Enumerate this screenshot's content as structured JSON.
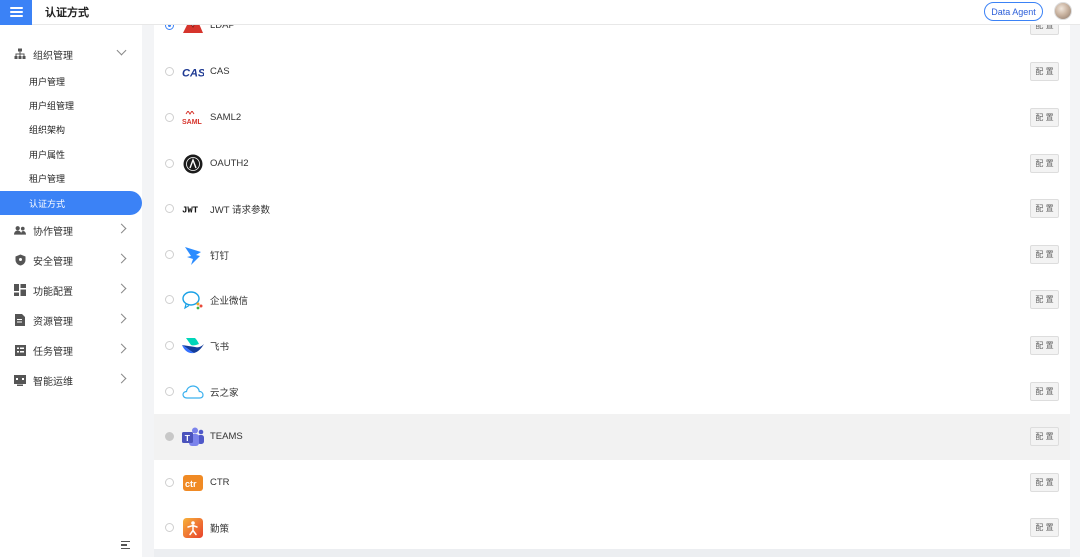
{
  "header": {
    "title": "认证方式",
    "agent_button": "Data Agent"
  },
  "sidebar": {
    "groups": [
      {
        "label": "组织管理",
        "icon": "org-icon",
        "expanded": true
      },
      {
        "label": "协作管理",
        "icon": "users-icon"
      },
      {
        "label": "安全管理",
        "icon": "shield-icon"
      },
      {
        "label": "功能配置",
        "icon": "grid-icon"
      },
      {
        "label": "资源管理",
        "icon": "file-icon"
      },
      {
        "label": "任务管理",
        "icon": "task-icon"
      },
      {
        "label": "智能运维",
        "icon": "monitor-icon"
      }
    ],
    "subitems": [
      "用户管理",
      "用户组管理",
      "组织架构",
      "用户属性",
      "租户管理",
      "认证方式"
    ],
    "active_subitem": "认证方式"
  },
  "auth_methods": [
    {
      "label": "LDAP",
      "logo": "ldap-logo",
      "selected": true
    },
    {
      "label": "CAS",
      "logo": "cas-logo"
    },
    {
      "label": "SAML2",
      "logo": "saml-logo"
    },
    {
      "label": "OAUTH2",
      "logo": "oauth-logo"
    },
    {
      "label": "JWT 请求参数",
      "logo": "jwt-logo"
    },
    {
      "label": "钉钉",
      "logo": "dingtalk-logo"
    },
    {
      "label": "企业微信",
      "logo": "wecom-logo"
    },
    {
      "label": "飞书",
      "logo": "feishu-logo"
    },
    {
      "label": "云之家",
      "logo": "yunzhijia-logo"
    },
    {
      "label": "TEAMS",
      "logo": "teams-logo",
      "hovered": true
    },
    {
      "label": "CTR",
      "logo": "ctr-logo"
    },
    {
      "label": "勤策",
      "logo": "qince-logo"
    }
  ],
  "config_button_label": "配 置",
  "colors": {
    "accent": "#3b82f6"
  }
}
